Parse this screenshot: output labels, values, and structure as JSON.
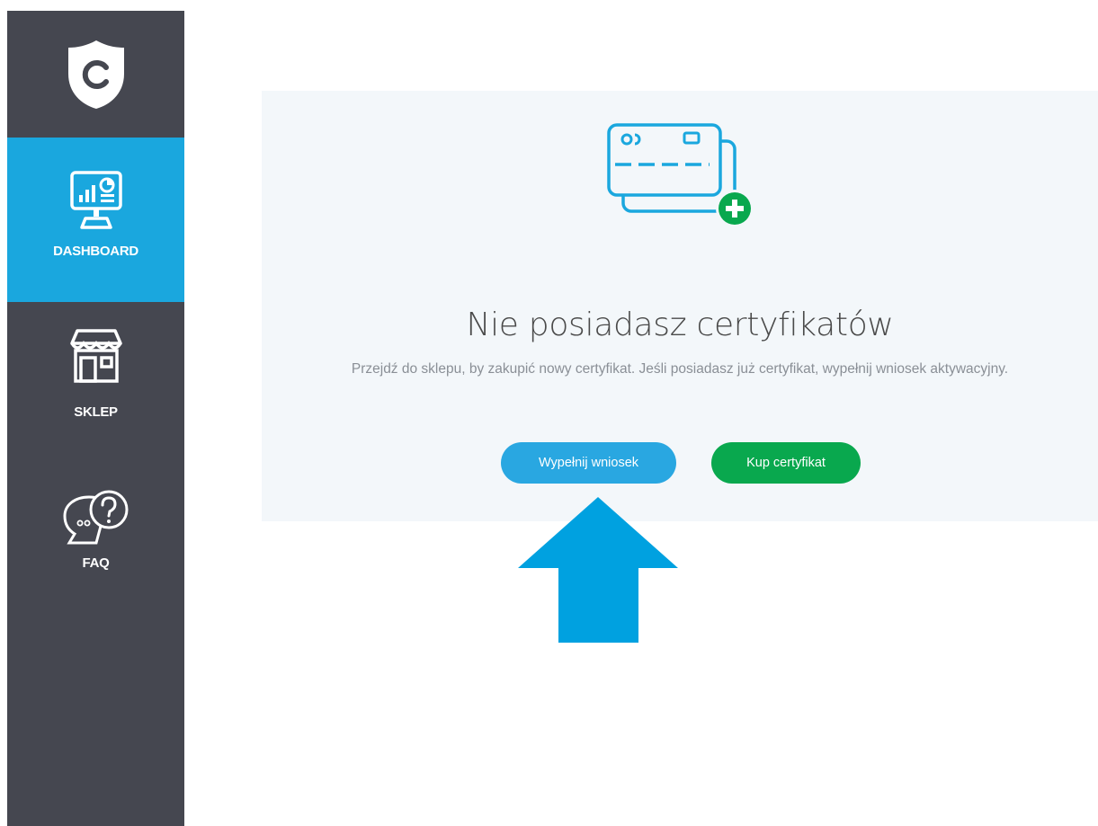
{
  "sidebar": {
    "logo_icon": "shield-c-logo",
    "items": [
      {
        "label": "DASHBOARD",
        "icon": "dashboard-monitor-icon",
        "active": true
      },
      {
        "label": "SKLEP",
        "icon": "shop-icon",
        "active": false
      },
      {
        "label": "FAQ",
        "icon": "faq-chat-question-icon",
        "active": false
      }
    ]
  },
  "main": {
    "icon": "credit-cards-plus-icon",
    "title": "Nie posiadasz certyfikatów",
    "subtitle": "Przejdź do sklepu, by zakupić nowy certyfikat. Jeśli posiadasz już certyfikat, wypełnij wniosek aktywacyjny.",
    "primary_button": "Wypełnij wniosek",
    "secondary_button": "Kup certyfikat"
  },
  "annotation": {
    "icon": "up-arrow-indicator"
  },
  "colors": {
    "sidebar_bg": "#454750",
    "active_bg": "#1aa7de",
    "primary": "#29a7e1",
    "green": "#09a84e",
    "panel_bg": "#f3f7fa",
    "arrow": "#00a1e0"
  }
}
